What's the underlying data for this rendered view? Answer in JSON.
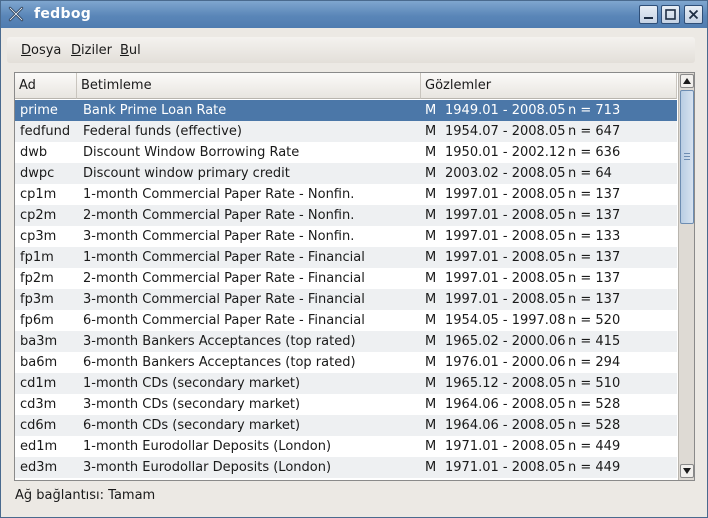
{
  "window": {
    "title": "fedbog"
  },
  "menu": [
    {
      "key": "D",
      "rest": "osya"
    },
    {
      "key": "D",
      "rest": "iziler"
    },
    {
      "key": "B",
      "rest": "ul"
    }
  ],
  "columns": {
    "ad": "Ad",
    "betimleme": "Betimleme",
    "gozlemler": "Gözlemler"
  },
  "rows": [
    {
      "ad": "prime",
      "betimleme": "Bank Prime Loan Rate",
      "freq": "M",
      "range": "1949.01 - 2008.05",
      "n": "n = 713",
      "selected": true
    },
    {
      "ad": "fedfund",
      "betimleme": "Federal funds (effective)",
      "freq": "M",
      "range": "1954.07 - 2008.05",
      "n": "n = 647"
    },
    {
      "ad": "dwb",
      "betimleme": "Discount Window Borrowing Rate",
      "freq": "M",
      "range": "1950.01 - 2002.12",
      "n": "n = 636"
    },
    {
      "ad": "dwpc",
      "betimleme": "Discount window primary credit",
      "freq": "M",
      "range": "2003.02 - 2008.05",
      "n": "n = 64"
    },
    {
      "ad": "cp1m",
      "betimleme": "1-month Commercial Paper Rate - Nonfin.",
      "freq": "M",
      "range": "1997.01 - 2008.05",
      "n": "n = 137"
    },
    {
      "ad": "cp2m",
      "betimleme": "2-month Commercial Paper Rate - Nonfin.",
      "freq": "M",
      "range": "1997.01 - 2008.05",
      "n": "n = 137"
    },
    {
      "ad": "cp3m",
      "betimleme": "3-month Commercial Paper Rate - Nonfin.",
      "freq": "M",
      "range": "1997.01 - 2008.05",
      "n": "n = 133"
    },
    {
      "ad": "fp1m",
      "betimleme": "1-month Commercial Paper Rate - Financial",
      "freq": "M",
      "range": "1997.01 - 2008.05",
      "n": "n = 137"
    },
    {
      "ad": "fp2m",
      "betimleme": "2-month Commercial Paper Rate - Financial",
      "freq": "M",
      "range": "1997.01 - 2008.05",
      "n": "n = 137"
    },
    {
      "ad": "fp3m",
      "betimleme": "3-month Commercial Paper Rate - Financial",
      "freq": "M",
      "range": "1997.01 - 2008.05",
      "n": "n = 137"
    },
    {
      "ad": "fp6m",
      "betimleme": "6-month Commercial Paper Rate - Financial",
      "freq": "M",
      "range": "1954.05 - 1997.08",
      "n": "n = 520"
    },
    {
      "ad": "ba3m",
      "betimleme": "3-month Bankers Acceptances (top rated)",
      "freq": "M",
      "range": "1965.02 - 2000.06",
      "n": "n = 415"
    },
    {
      "ad": "ba6m",
      "betimleme": "6-month Bankers Acceptances (top rated)",
      "freq": "M",
      "range": "1976.01 - 2000.06",
      "n": "n = 294"
    },
    {
      "ad": "cd1m",
      "betimleme": "1-month CDs (secondary market)",
      "freq": "M",
      "range": "1965.12 - 2008.05",
      "n": "n = 510"
    },
    {
      "ad": "cd3m",
      "betimleme": "3-month CDs (secondary market)",
      "freq": "M",
      "range": "1964.06 - 2008.05",
      "n": "n = 528"
    },
    {
      "ad": "cd6m",
      "betimleme": "6-month CDs (secondary market)",
      "freq": "M",
      "range": "1964.06 - 2008.05",
      "n": "n = 528"
    },
    {
      "ad": "ed1m",
      "betimleme": "1-month Eurodollar Deposits (London)",
      "freq": "M",
      "range": "1971.01 - 2008.05",
      "n": "n = 449"
    },
    {
      "ad": "ed3m",
      "betimleme": "3-month Eurodollar Deposits (London)",
      "freq": "M",
      "range": "1971.01 - 2008.05",
      "n": "n = 449"
    }
  ],
  "status": "Ağ bağlantısı: Tamam",
  "colors": {
    "selection": "#4b77a8",
    "titlebar": "#5a86b8"
  },
  "icons": [
    "app-x-icon",
    "minimize-icon",
    "maximize-icon",
    "close-icon",
    "scroll-up-icon",
    "scroll-down-icon"
  ]
}
